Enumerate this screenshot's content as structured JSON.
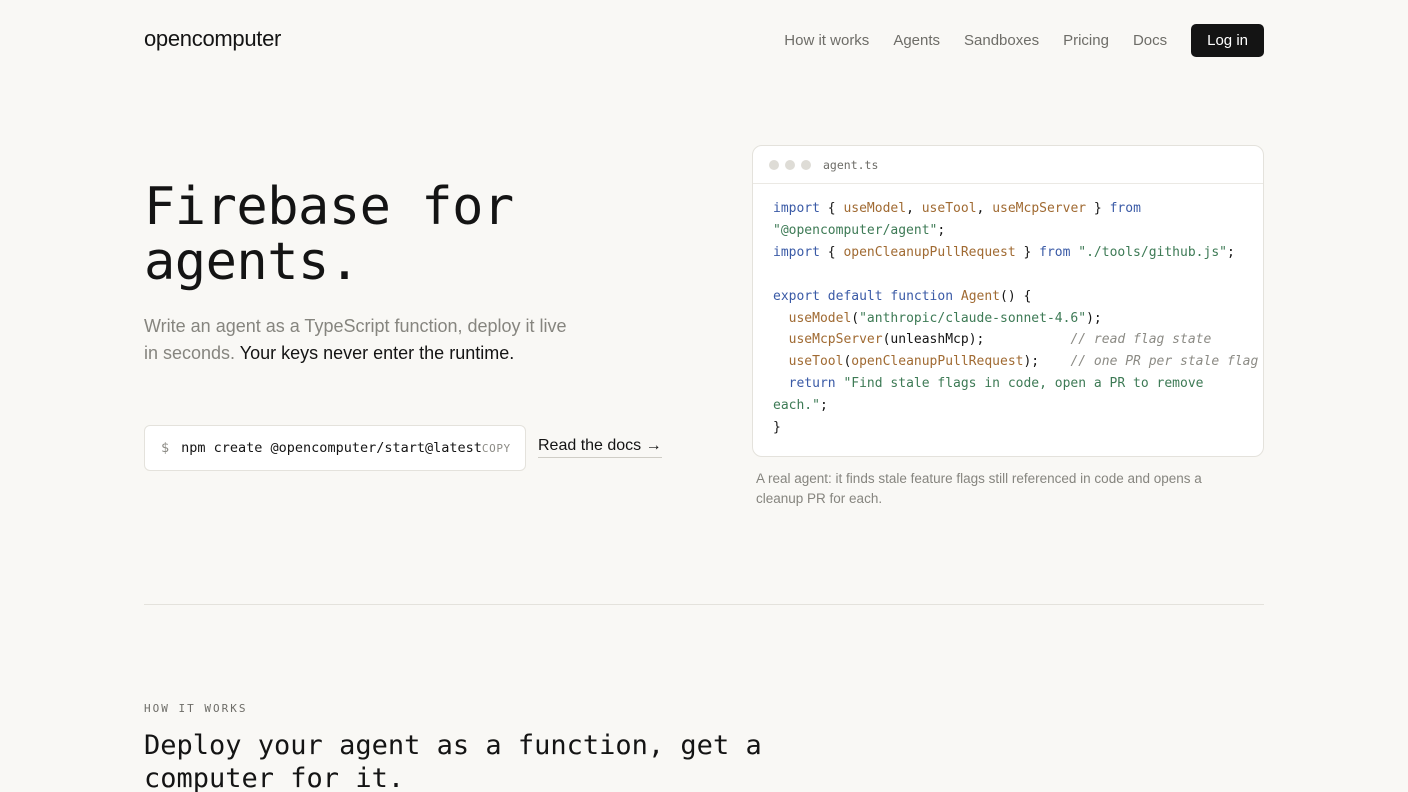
{
  "header": {
    "logo": "opencomputer",
    "nav": [
      {
        "label": "How it works"
      },
      {
        "label": "Agents"
      },
      {
        "label": "Sandboxes"
      },
      {
        "label": "Pricing"
      },
      {
        "label": "Docs"
      }
    ],
    "login_label": "Log in"
  },
  "hero": {
    "title_line1": "Firebase for",
    "title_line2": "agents.",
    "subtitle_plain": "Write an agent as a TypeScript function, deploy it live in seconds. ",
    "subtitle_strong": "Your keys never enter the runtime.",
    "command_prompt": "$",
    "command": "npm create @opencomputer/start@latest",
    "copy_label": "COPY",
    "docs_link": "Read the docs →"
  },
  "code_card": {
    "filename": "agent.ts",
    "tokens": {
      "import": "import",
      "from": "from",
      "export": "export",
      "default": "default",
      "function": "function",
      "return": "return",
      "useModel": "useModel",
      "useTool": "useTool",
      "useMcpServer": "useMcpServer",
      "openCleanupPullRequest": "openCleanupPullRequest",
      "Agent": "Agent",
      "pkg_agent": "\"@opencomputer/agent\"",
      "pkg_tools": "\"./tools/github.js\"",
      "model_id": "\"anthropic/claude-sonnet-4.6\"",
      "unleashMcp": "unleashMcp",
      "comment_flags": "// read flag state",
      "comment_pr": "// one PR per stale flag",
      "return_str_a": "\"Find stale flags in code, open a PR to remove",
      "return_str_b": "each.\""
    },
    "caption": "A real agent: it finds stale feature flags still referenced in code and opens a cleanup PR for each."
  },
  "how_it_works": {
    "eyebrow": "HOW IT WORKS",
    "title": "Deploy your agent as a function, get a computer for it."
  },
  "colors": {
    "background": "#f9f8f5",
    "text": "#141414",
    "muted": "#86857f",
    "keyword": "#3a5aa6",
    "identifier": "#a06a32",
    "string": "#3d7a55",
    "comment": "#8c8b85"
  }
}
